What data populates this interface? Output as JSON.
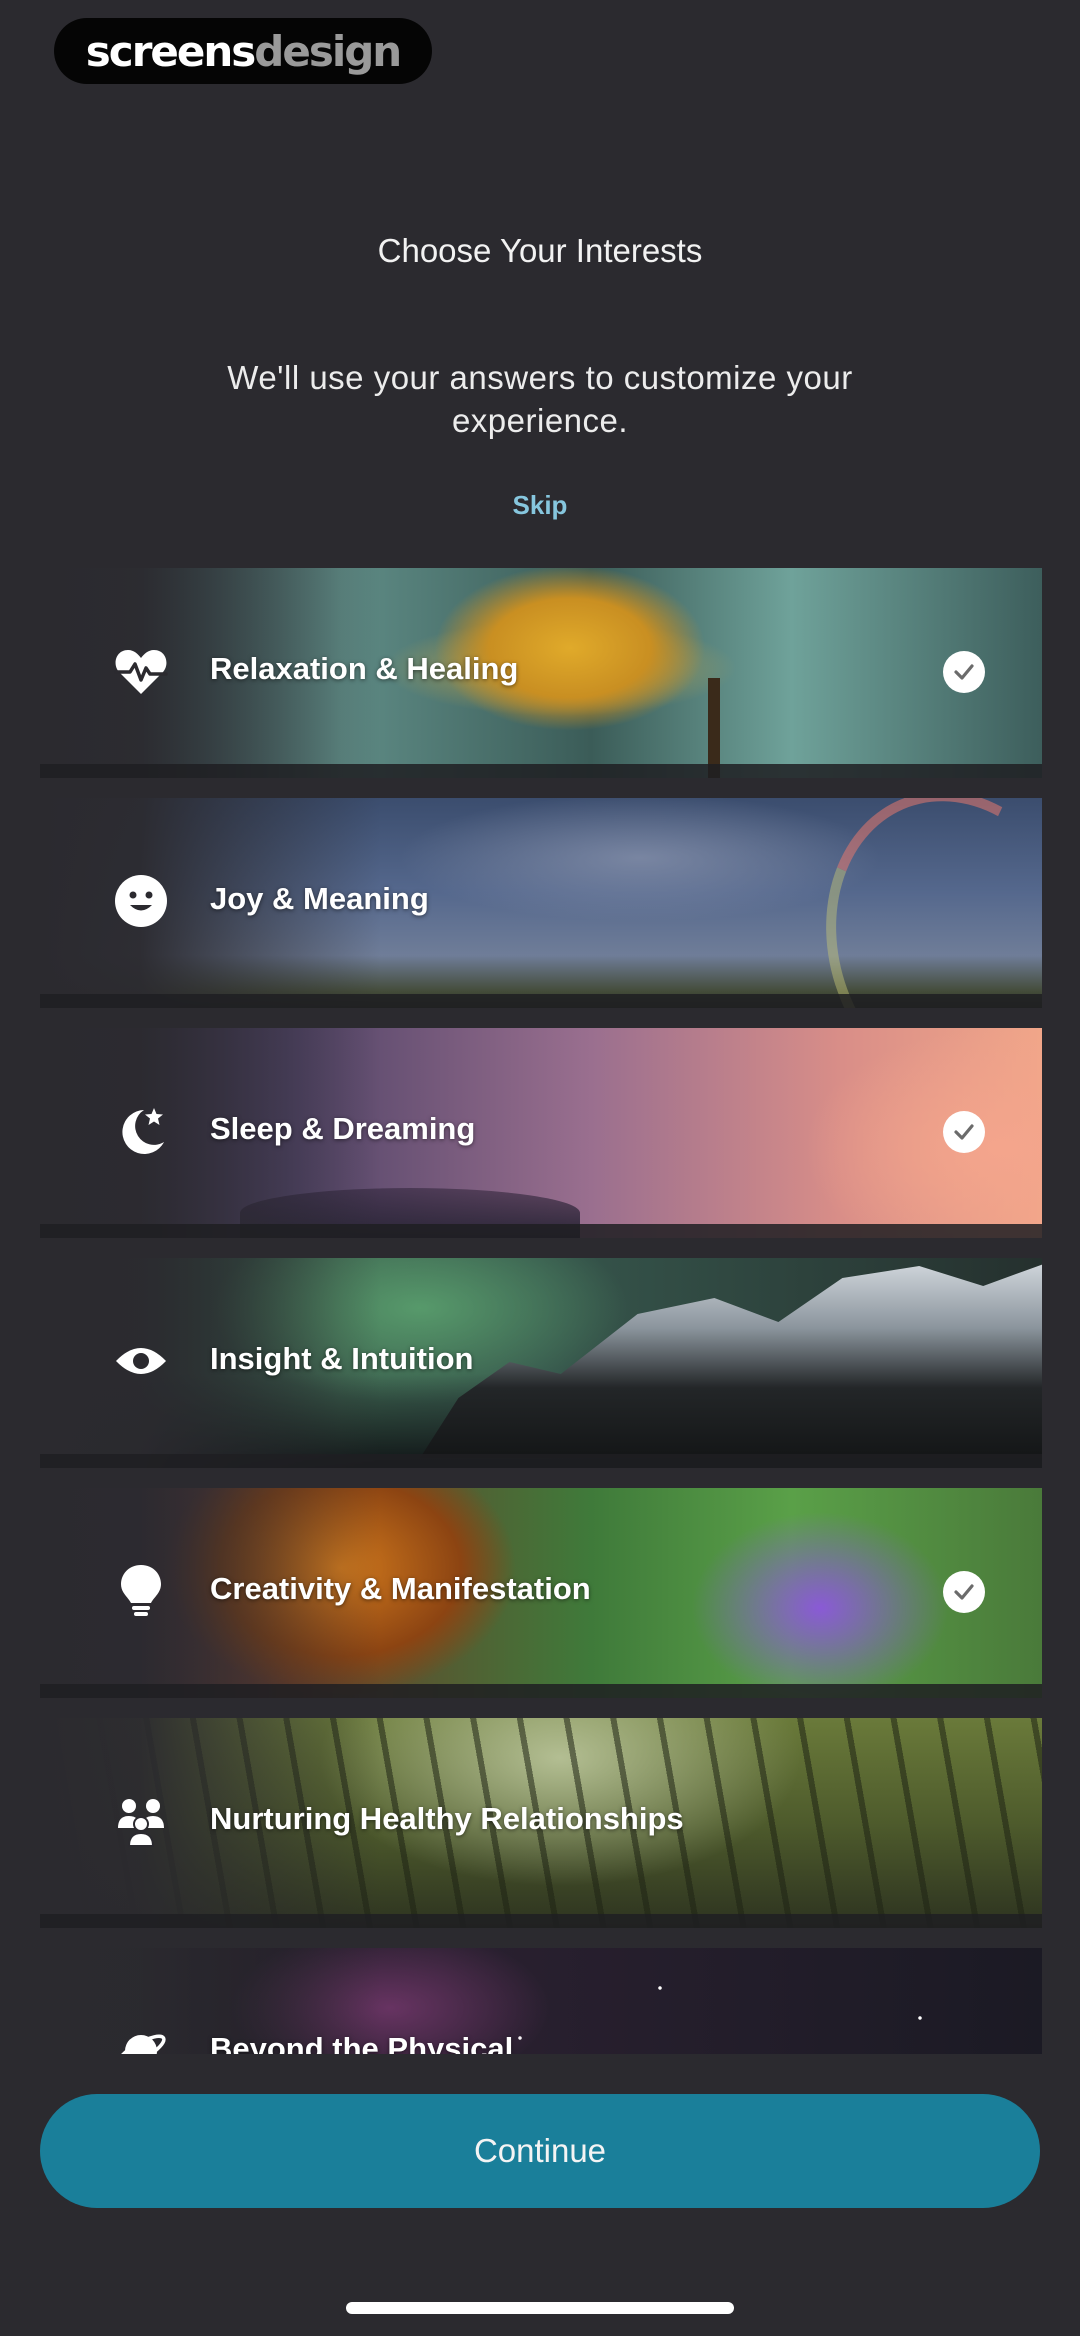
{
  "watermark": {
    "part1": "screens",
    "part2": "design"
  },
  "header": {
    "title": "Choose Your Interests",
    "subtitle": "We'll use your answers to customize your experience.",
    "skip": "Skip"
  },
  "interests": [
    {
      "label": "Relaxation & Healing",
      "icon": "heart-pulse-icon",
      "selected": true
    },
    {
      "label": "Joy & Meaning",
      "icon": "smiley-icon",
      "selected": false
    },
    {
      "label": "Sleep & Dreaming",
      "icon": "moon-star-icon",
      "selected": true
    },
    {
      "label": "Insight & Intuition",
      "icon": "eye-icon",
      "selected": false
    },
    {
      "label": "Creativity & Manifestation",
      "icon": "lightbulb-icon",
      "selected": true
    },
    {
      "label": "Nurturing Healthy Relationships",
      "icon": "people-icon",
      "selected": false
    },
    {
      "label": "Beyond the Physical",
      "icon": "planet-icon",
      "selected": false
    }
  ],
  "footer": {
    "continue": "Continue"
  },
  "colors": {
    "background": "#2b2a2f",
    "accent": "#1a7f9a",
    "skip_link": "#86c6de"
  }
}
